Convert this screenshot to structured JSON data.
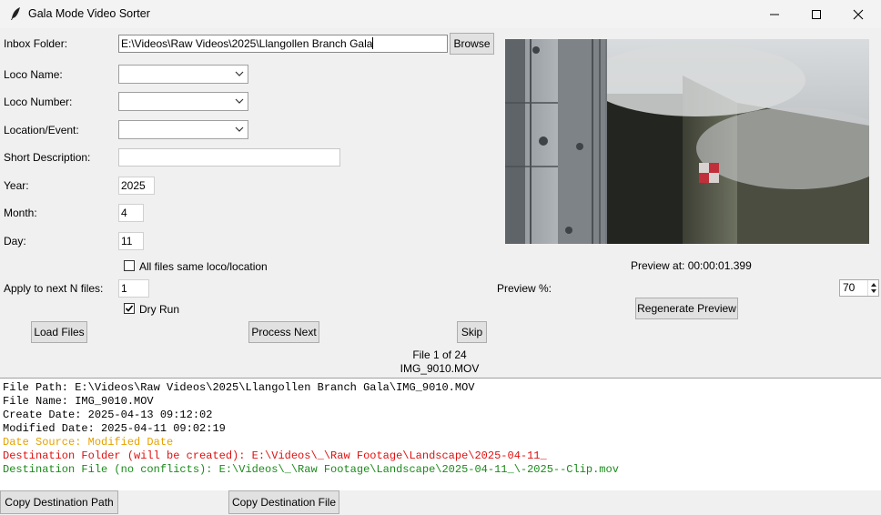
{
  "window": {
    "title": "Gala Mode Video Sorter",
    "minimize": "minimize",
    "maximize": "maximize",
    "close": "close"
  },
  "form": {
    "inbox_label": "Inbox Folder:",
    "inbox_value": "E:\\Videos\\Raw Videos\\2025\\Llangollen Branch Gala",
    "browse": "Browse",
    "loco_name_label": "Loco Name:",
    "loco_name_value": "",
    "loco_number_label": "Loco Number:",
    "loco_number_value": "",
    "location_label": "Location/Event:",
    "location_value": "",
    "short_desc_label": "Short Description:",
    "short_desc_value": "",
    "year_label": "Year:",
    "year_value": "2025",
    "month_label": "Month:",
    "month_value": "4",
    "day_label": "Day:",
    "day_value": "11",
    "all_same_label": "All files same loco/location",
    "all_same_checked": false,
    "apply_next_label": "Apply to next N files:",
    "apply_next_value": "1",
    "dry_run_label": "Dry Run",
    "dry_run_checked": true
  },
  "preview": {
    "at_label": "Preview at: 00:00:01.399",
    "percent_label": "Preview %:",
    "percent_value": "70",
    "regenerate": "Regenerate Preview"
  },
  "actions": {
    "load": "Load Files",
    "process": "Process Next",
    "skip": "Skip"
  },
  "status": {
    "file_counter": "File 1 of 24",
    "file_name": "IMG_9010.MOV"
  },
  "log": {
    "lines": [
      {
        "text": "File Path: E:\\Videos\\Raw Videos\\2025\\Llangollen Branch Gala\\IMG_9010.MOV",
        "color": "#000000"
      },
      {
        "text": "File Name: IMG_9010.MOV",
        "color": "#000000"
      },
      {
        "text": "Create Date: 2025-04-13 09:12:02",
        "color": "#000000"
      },
      {
        "text": "Modified Date: 2025-04-11 09:02:19",
        "color": "#000000"
      },
      {
        "text": "Date Source: Modified Date",
        "color": "#e6a100"
      },
      {
        "text": "Destination Folder (will be created): E:\\Videos\\_\\Raw Footage\\Landscape\\2025-04-11_",
        "color": "#e01010"
      },
      {
        "text": "Destination File (no conflicts): E:\\Videos\\_\\Raw Footage\\Landscape\\2025-04-11_\\-2025--Clip.mov",
        "color": "#1a8a1a"
      }
    ]
  },
  "bottom": {
    "copy_path": "Copy Destination Path",
    "copy_file": "Copy Destination File"
  }
}
